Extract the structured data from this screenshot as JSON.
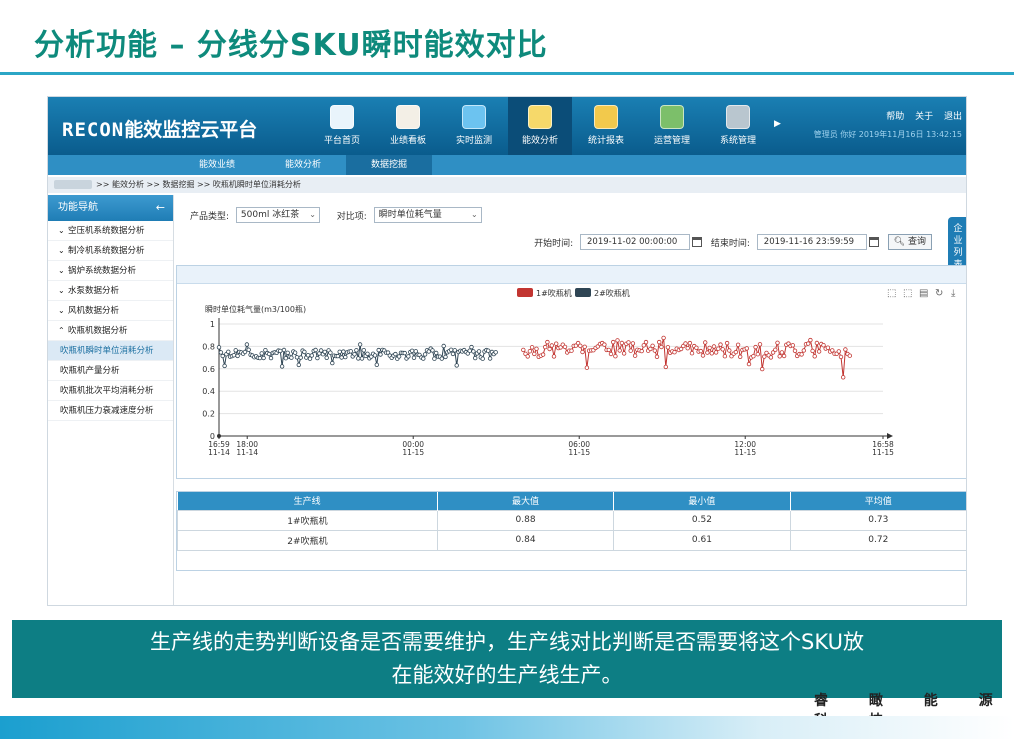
{
  "slide": {
    "title": "分析功能 – 分线分SKU瞬时能效对比",
    "caption_line1": "生产线的走势判断设备是否需要维护，生产线对比判断是否需要将这个SKU放",
    "caption_line2": "在能效好的生产线生产。",
    "company": "睿 瞰 能 源 科 技"
  },
  "app": {
    "logo_brand": "RECON",
    "logo_text": "能效监控云平台",
    "nav": [
      {
        "label": "平台首页",
        "icon": "globe-search-icon",
        "color": "#e9f4fb"
      },
      {
        "label": "业绩看板",
        "icon": "report-chart-icon",
        "color": "#f3efe6"
      },
      {
        "label": "实时监测",
        "icon": "monitor-gauge-icon",
        "color": "#6cc3f0"
      },
      {
        "label": "能效分析",
        "icon": "bar-chart-board-icon",
        "color": "#f6d96a",
        "active": true
      },
      {
        "label": "统计报表",
        "icon": "screen-table-icon",
        "color": "#f2c94c"
      },
      {
        "label": "运营管理",
        "icon": "person-wrench-icon",
        "color": "#7cbf6a"
      },
      {
        "label": "系统管理",
        "icon": "gear-icon",
        "color": "#b9c6cf"
      }
    ],
    "top_links": {
      "help": "帮助",
      "about": "关于",
      "logout": "退出"
    },
    "user_info": "管理员 你好 2019年11月16日 13:42:15",
    "subnav": [
      "能效业绩",
      "能效分析",
      "数据挖掘"
    ],
    "breadcrumb": ">> 能效分析 >> 数据挖掘 >> 吹瓶机瞬时单位消耗分析"
  },
  "sidebar": {
    "title": "功能导航",
    "back": "←",
    "items": [
      {
        "label": "空压机系统数据分析",
        "chev": "⌄"
      },
      {
        "label": "制冷机系统数据分析",
        "chev": "⌄"
      },
      {
        "label": "锅炉系统数据分析",
        "chev": "⌄"
      },
      {
        "label": "水泵数据分析",
        "chev": "⌄"
      },
      {
        "label": "风机数据分析",
        "chev": "⌄"
      },
      {
        "label": "吹瓶机数据分析",
        "chev": "⌃"
      },
      {
        "label": "吹瓶机瞬时单位消耗分析",
        "chev": ""
      },
      {
        "label": "吹瓶机产量分析",
        "chev": ""
      },
      {
        "label": "吹瓶机批次平均消耗分析",
        "chev": ""
      },
      {
        "label": "吹瓶机压力衰减速度分析",
        "chev": ""
      }
    ]
  },
  "filters": {
    "product_label": "产品类型:",
    "product_value": "500ml 冰红茶",
    "compare_label": "对比项:",
    "compare_value": "瞬时单位耗气量",
    "start_label": "开始时间:",
    "start_value": "2019-11-02 00:00:00",
    "end_label": "结束时间:",
    "end_value": "2019-11-16 23:59:59",
    "query": "查询"
  },
  "side_tab": "企业列表",
  "chart_data": {
    "type": "line",
    "ylabel": "瞬时单位耗气量(m3/100瓶)",
    "ylim": [
      0,
      1
    ],
    "yticks": [
      "0",
      "0.2",
      "0.4",
      "0.6",
      "0.8",
      "1"
    ],
    "xticks": [
      {
        "label": "16:59",
        "date": "11-14",
        "t": 0
      },
      {
        "label": "18:00",
        "date": "11-14",
        "t": 1.02
      },
      {
        "label": "00:00",
        "date": "11-15",
        "t": 7.02
      },
      {
        "label": "06:00",
        "date": "11-15",
        "t": 13.02
      },
      {
        "label": "12:00",
        "date": "11-15",
        "t": 19.02
      },
      {
        "label": "16:58",
        "date": "11-15",
        "t": 24
      }
    ],
    "x_unit": "hours since 2019-11-14 16:59",
    "series": [
      {
        "name": "1#吹瓶机",
        "color": "#c23531",
        "start": 11.0,
        "end": 22.8,
        "base": 0.77,
        "spread": 0.07,
        "min": 0.52,
        "max": 0.88
      },
      {
        "name": "2#吹瓶机",
        "color": "#2f4554",
        "start": 0.0,
        "end": 10.0,
        "base": 0.73,
        "spread": 0.04,
        "min": 0.61,
        "max": 0.84
      }
    ],
    "toolbox": [
      "zoom-icon",
      "zoom-reset-icon",
      "data-view-icon",
      "restore-icon",
      "download-icon"
    ]
  },
  "table": {
    "headers": [
      "生产线",
      "最大值",
      "最小值",
      "平均值"
    ],
    "rows": [
      [
        "1#吹瓶机",
        "0.88",
        "0.52",
        "0.73"
      ],
      [
        "2#吹瓶机",
        "0.84",
        "0.61",
        "0.72"
      ]
    ]
  }
}
